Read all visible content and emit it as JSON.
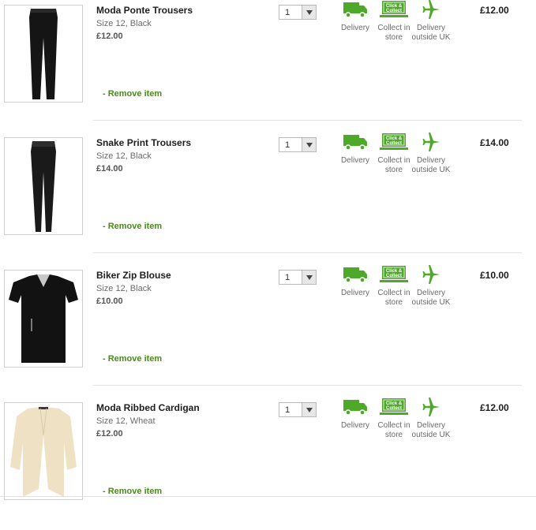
{
  "options": {
    "delivery": "Delivery",
    "collect_line1": "Collect in",
    "collect_line2": "store",
    "outside_line1": "Delivery",
    "outside_line2": "outside UK",
    "click_collect_line1": "Click &",
    "click_collect_line2": "Collect"
  },
  "remove_label": "- Remove item",
  "colors": {
    "accent_green": "#4ea82a",
    "link_green": "#4b8b1b"
  },
  "items": [
    {
      "name": "Moda Ponte Trousers",
      "size": "Size 12, Black",
      "unit_price": "£12.00",
      "qty": "1",
      "total": "£12.00",
      "image": "black-trousers"
    },
    {
      "name": "Snake Print Trousers",
      "size": "Size 12, Black",
      "unit_price": "£14.00",
      "qty": "1",
      "total": "£14.00",
      "image": "snake-trousers"
    },
    {
      "name": "Biker Zip Blouse",
      "size": "Size 12, Black",
      "unit_price": "£10.00",
      "qty": "1",
      "total": "£10.00",
      "image": "black-blouse"
    },
    {
      "name": "Moda Ribbed Cardigan",
      "size": "Size 12, Wheat",
      "unit_price": "£12.00",
      "qty": "1",
      "total": "£12.00",
      "image": "wheat-cardigan"
    }
  ]
}
